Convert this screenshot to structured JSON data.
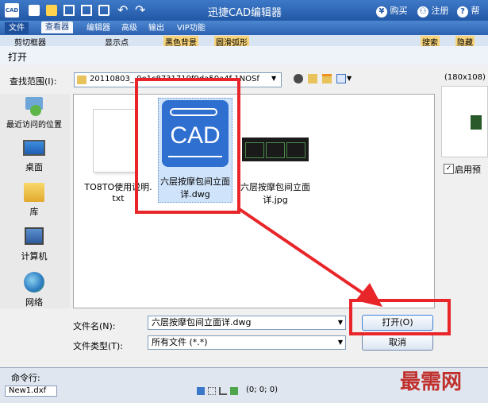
{
  "app": {
    "title": "迅捷CAD编辑器",
    "logo_text": "CAD",
    "right_links": [
      {
        "icon": "yen-icon",
        "glyph": "¥",
        "label": "购买"
      },
      {
        "icon": "user-icon",
        "glyph": "⚇",
        "label": "注册"
      },
      {
        "icon": "help-icon",
        "glyph": "?",
        "label": "帮"
      }
    ]
  },
  "menu": {
    "items": [
      "文件",
      "查看器",
      "编辑器",
      "高级",
      "输出",
      "VIP功能"
    ]
  },
  "ribbon": {
    "items": [
      "剪切框器",
      "显示点",
      "黑色背景",
      "圆滑弧形",
      "搜索",
      "隐藏"
    ]
  },
  "dialog": {
    "title": "打开",
    "look_in_label": "查找范围(I):",
    "look_in_value": "20110803_ 9e1c8731719f9da50a4f 1NOSf",
    "places": [
      {
        "icon": "recent-places-icon",
        "label": "最近访问的位置"
      },
      {
        "icon": "desktop-icon",
        "label": "桌面"
      },
      {
        "icon": "library-icon",
        "label": "库"
      },
      {
        "icon": "computer-icon",
        "label": "计算机"
      },
      {
        "icon": "network-icon",
        "label": "网络"
      }
    ],
    "files": [
      {
        "icon": "text-file-icon",
        "name_line1": "TO8TO使用说明.",
        "name_line2": "txt"
      },
      {
        "icon": "cad-file-icon",
        "name_line1": "六层按摩包间立面",
        "name_line2": "详.dwg",
        "thumb_text": "CAD"
      },
      {
        "icon": "image-file-icon",
        "name_line1": "六层按摩包间立面",
        "name_line2": "详.jpg"
      }
    ],
    "preview_size": "(180x108)",
    "enable_preview_label": "启用预",
    "enable_preview_checked": true,
    "filename_label": "文件名(N):",
    "filename_value": "六层按摩包间立面详.dwg",
    "filetype_label": "文件类型(T):",
    "filetype_value": "所有文件 (*.*)",
    "open_button": "打开(O)",
    "cancel_button": "取消"
  },
  "status": {
    "command_label": "命令行:",
    "document_tab": "New1.dxf",
    "coords": "(0; 0; 0)"
  },
  "watermark": "最需网",
  "colors": {
    "highlight_red": "#e8262a",
    "title_blue": "#2258a6",
    "cad_icon_blue": "#2f6fd0",
    "watermark": "#c0302c"
  }
}
